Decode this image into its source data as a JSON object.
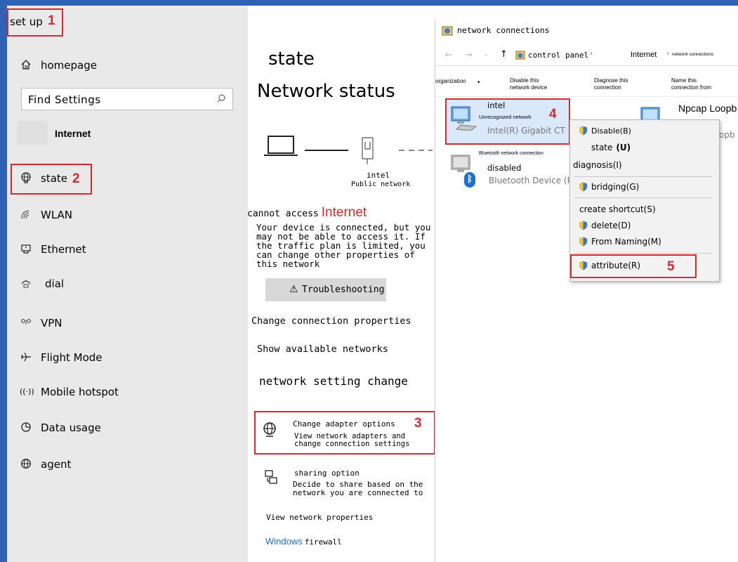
{
  "settings": {
    "title": "set up",
    "homepage": "homepage",
    "search_placeholder": "Find Settings",
    "section": "Internet",
    "nav": [
      "state",
      "WLAN",
      "Ethernet",
      "dial",
      "VPN",
      "Flight Mode",
      "Mobile hotspot",
      "Data usage",
      "agent"
    ]
  },
  "status": {
    "heading": "state",
    "subheading": "Network status",
    "adapter_name": "intel",
    "network_type": "Public network",
    "cannot_access": "cannot access",
    "internet_word": "Internet",
    "message": "Your device is connected, but you may not be able to access it. If the traffic plan is limited, you can change other properties of this network",
    "troubleshoot": "Troubleshooting",
    "change_props": "Change connection properties",
    "show_networks": "Show available networks",
    "setting_change": "network setting change",
    "adapter_title": "Change adapter options",
    "adapter_desc": "View network adapters and change connection settings",
    "sharing_title": "sharing option",
    "sharing_desc": "Decide to share based on the network you are connected to",
    "view_props": "View network properties",
    "firewall_a": "Windows",
    "firewall_b": "firewall"
  },
  "explorer": {
    "title": "network connections",
    "breadcrumb_a": "control panel",
    "breadcrumb_b": "Internet",
    "breadcrumb_c": "network connections",
    "toolbar": [
      "organization",
      "Disable this network device",
      "Diagnose this connection",
      "Name this connection from"
    ],
    "conn1_name": "intel",
    "conn1_status": "Unrecognized network",
    "conn1_device": "Intel(R) Gigabit CT",
    "conn2_name": "Bluetooth network connection",
    "conn2_status": "disabled",
    "conn2_device": "Bluetooth Device (P",
    "conn3_name": "Npcap Loopb",
    "conn3_device": "opb"
  },
  "context_menu": {
    "items": [
      "Disable(B)",
      "state",
      "(U)",
      "diagnosis(I)",
      "bridging(G)",
      "create shortcut(S)",
      "delete(D)",
      "From Naming(M)",
      "attribute(R)"
    ]
  },
  "annotations": [
    "1",
    "2",
    "3",
    "4",
    "5"
  ],
  "colors": {
    "annotation_red": "#d7282f",
    "accent_blue": "#2f62b5",
    "link_blue": "#1a6fd1"
  }
}
